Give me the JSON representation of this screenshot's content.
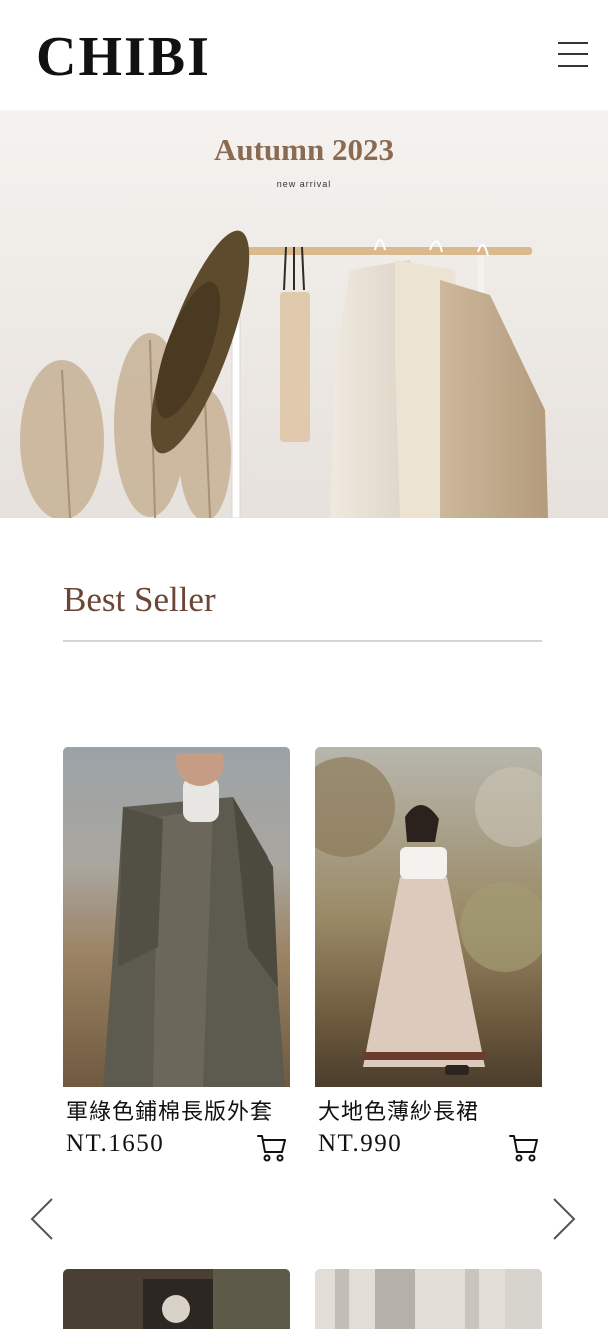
{
  "header": {
    "logo": "CHIBI",
    "menu_icon": "hamburger-menu-icon"
  },
  "hero": {
    "title": "Autumn 2023",
    "subtitle": "new  arrival"
  },
  "best_seller": {
    "title": "Best Seller",
    "products": [
      {
        "name": "軍綠色鋪棉長版外套",
        "price": "NT.1650",
        "cart_icon": "cart-icon"
      },
      {
        "name": "大地色薄紗長裙",
        "price": "NT.990",
        "cart_icon": "cart-icon"
      }
    ],
    "prev_icon": "chevron-left-icon",
    "next_icon": "chevron-right-icon"
  },
  "colors": {
    "brand_text": "#111111",
    "section_title": "#6b4636",
    "hero_title": "#8b6a52",
    "divider": "#d5d5d5"
  }
}
